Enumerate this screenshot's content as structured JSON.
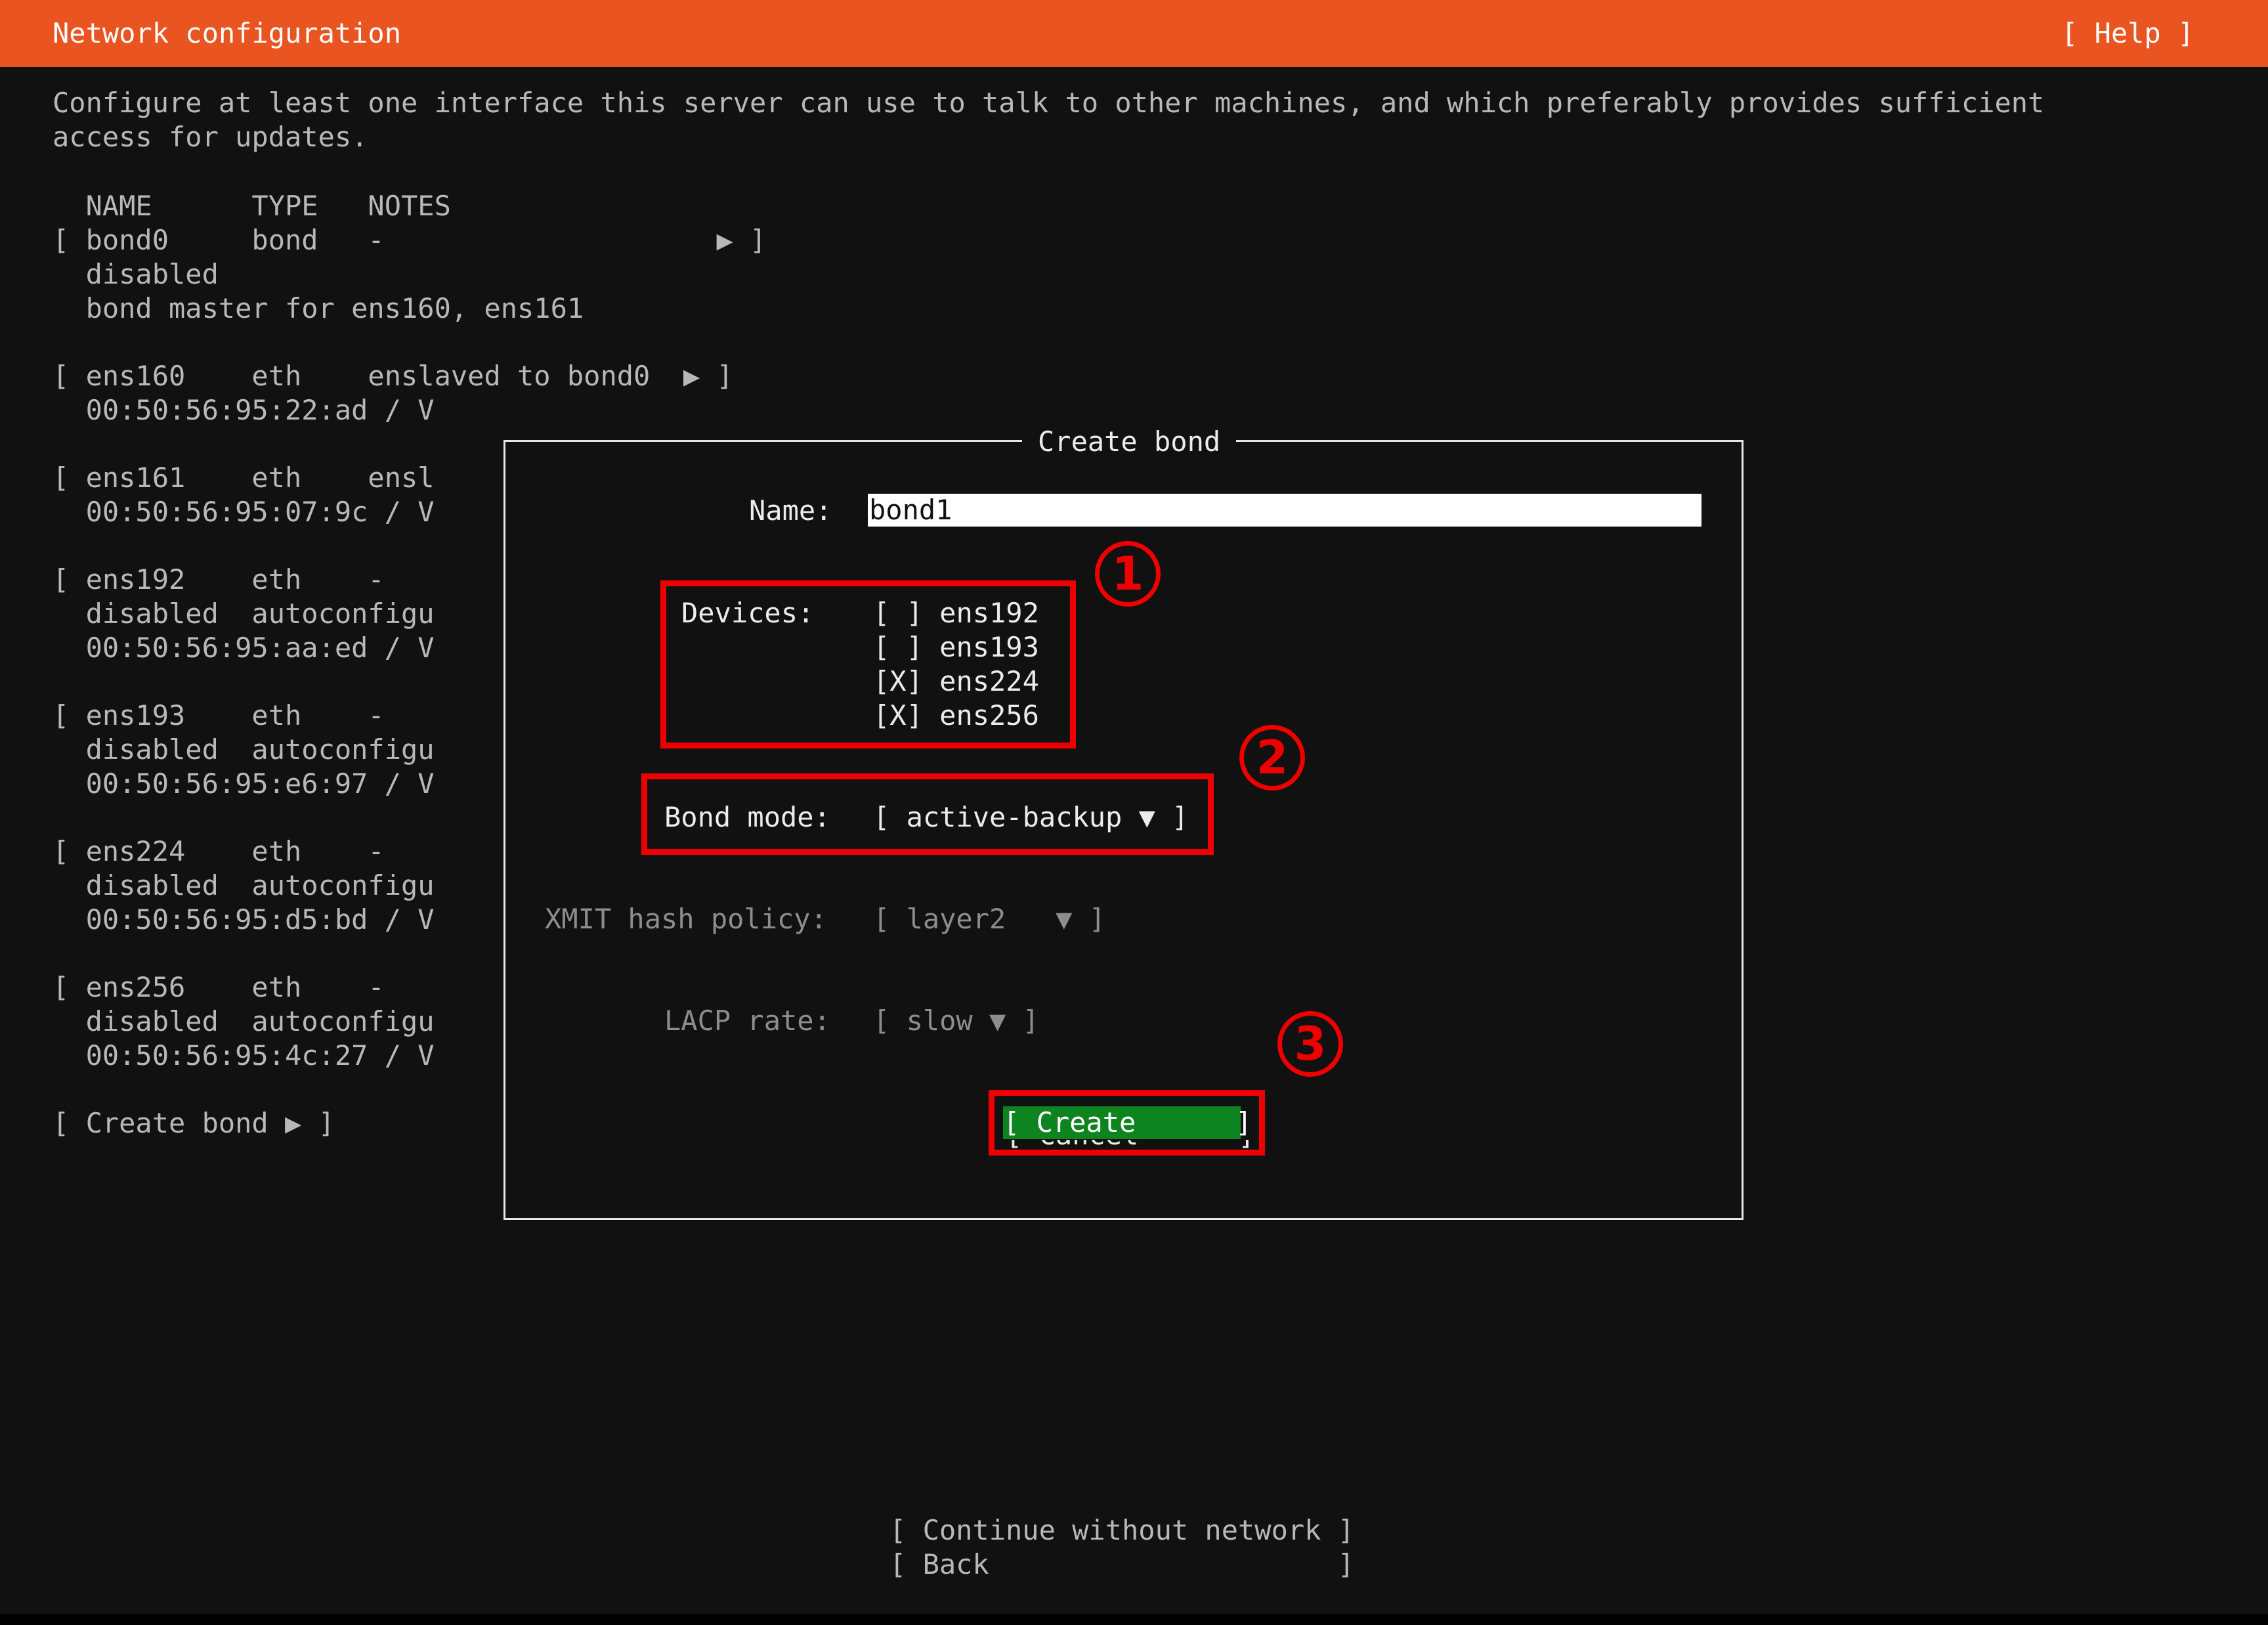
{
  "header": {
    "title": "Network configuration",
    "help_label": "[ Help ]"
  },
  "intro": {
    "line1": "Configure at least one interface this server can use to talk to other machines, and which preferably provides sufficient",
    "line2": "access for updates."
  },
  "table": {
    "header": "  NAME      TYPE   NOTES",
    "rows": [
      {
        "line1": "[ bond0     bond   -                    ▶ ]",
        "line2": "  disabled",
        "line3": "  bond master for ens160, ens161"
      },
      {
        "line1": "[ ens160    eth    enslaved to bond0  ▶ ]",
        "line2": "  00:50:56:95:22:ad / V"
      },
      {
        "line1": "[ ens161    eth    ensl",
        "line2": "  00:50:56:95:07:9c / V"
      },
      {
        "line1": "[ ens192    eth    -",
        "line2": "  disabled  autoconfigu",
        "line3": "  00:50:56:95:aa:ed / V"
      },
      {
        "line1": "[ ens193    eth    -",
        "line2": "  disabled  autoconfigu",
        "line3": "  00:50:56:95:e6:97 / V"
      },
      {
        "line1": "[ ens224    eth    -",
        "line2": "  disabled  autoconfigu",
        "line3": "  00:50:56:95:d5:bd / V"
      },
      {
        "line1": "[ ens256    eth    -",
        "line2": "  disabled  autoconfigu",
        "line3": "  00:50:56:95:4c:27 / V"
      }
    ],
    "create_bond": "[ Create bond ▶ ]"
  },
  "dialog": {
    "title": "Create bond",
    "name_label": "Name:",
    "name_value": "bond1",
    "devices_label": "Devices:",
    "devices": [
      {
        "checkbox": "[ ]",
        "name": "ens192"
      },
      {
        "checkbox": "[ ]",
        "name": "ens193"
      },
      {
        "checkbox": "[X]",
        "name": "ens224"
      },
      {
        "checkbox": "[X]",
        "name": "ens256"
      }
    ],
    "bond_mode_label": "Bond mode:",
    "bond_mode_value": "[ active-backup ▼ ]",
    "xmit_label": "XMIT hash policy:",
    "xmit_value": "[ layer2   ▼ ]",
    "lacp_label": "LACP rate:",
    "lacp_value": "[ slow ▼ ]",
    "create_label": "[ Create      ]",
    "cancel_label": "[ Cancel      ]"
  },
  "annotations": {
    "badge1": "1",
    "badge2": "2",
    "badge3": "3"
  },
  "footer": {
    "continue_label": "[ Continue without network ]",
    "back_label": "[ Back                     ]"
  },
  "colors": {
    "accent": "#e95420",
    "highlight": "#0e8420",
    "annotation": "#ee0000",
    "background": "#111111"
  }
}
